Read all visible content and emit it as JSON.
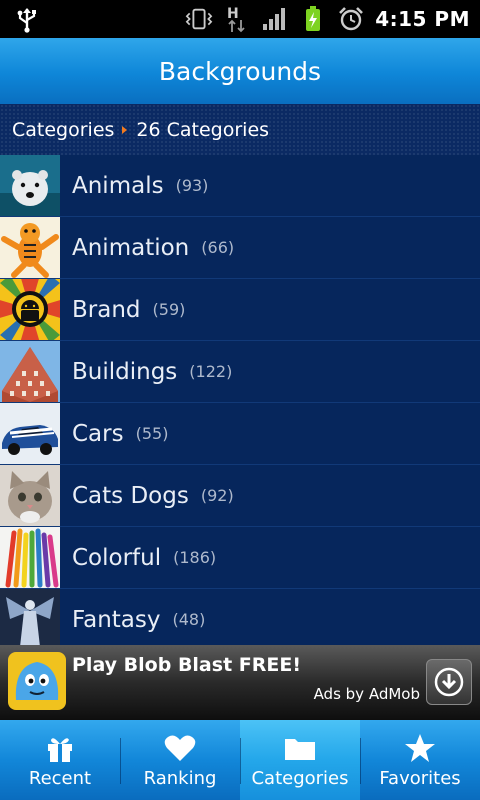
{
  "status_bar": {
    "time": "4:15 PM",
    "icons": [
      "usb-icon",
      "vibrate-icon",
      "hspa-data-icon",
      "signal-icon",
      "battery-charging-icon",
      "alarm-icon"
    ]
  },
  "header": {
    "title": "Backgrounds"
  },
  "breadcrumb": {
    "root": "Categories",
    "current": "26 Categories"
  },
  "categories": [
    {
      "label": "Animals",
      "count": "(93)",
      "icon": "polar-bear-thumbnail"
    },
    {
      "label": "Animation",
      "count": "(66)",
      "icon": "tigger-thumbnail"
    },
    {
      "label": "Brand",
      "count": "(59)",
      "icon": "android-logo-thumbnail"
    },
    {
      "label": "Buildings",
      "count": "(122)",
      "icon": "building-thumbnail"
    },
    {
      "label": "Cars",
      "count": "(55)",
      "icon": "car-thumbnail"
    },
    {
      "label": "Cats Dogs",
      "count": "(92)",
      "icon": "kitten-thumbnail"
    },
    {
      "label": "Colorful",
      "count": "(186)",
      "icon": "colored-pencils-thumbnail"
    },
    {
      "label": "Fantasy",
      "count": "(48)",
      "icon": "angel-thumbnail"
    }
  ],
  "ad": {
    "title": "Play Blob Blast FREE!",
    "attribution": "Ads by AdMob",
    "icon": "blob-icon"
  },
  "tabs": [
    {
      "label": "Recent",
      "icon": "gift-icon",
      "active": false
    },
    {
      "label": "Ranking",
      "icon": "heart-icon",
      "active": false
    },
    {
      "label": "Categories",
      "icon": "folder-icon",
      "active": true
    },
    {
      "label": "Favorites",
      "icon": "star-icon",
      "active": false
    }
  ],
  "colors": {
    "accent": "#1287d9",
    "list_background": "#06265c",
    "breadcrumb_separator": "#f07a20"
  }
}
